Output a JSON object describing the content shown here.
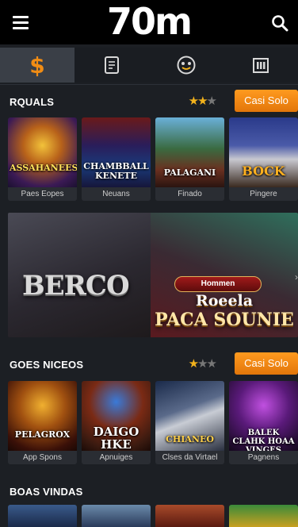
{
  "header": {
    "logo": "70m"
  },
  "tabs": [
    {
      "name": "tab-casino",
      "active": true
    },
    {
      "name": "tab-sports",
      "active": false
    },
    {
      "name": "tab-live",
      "active": false
    },
    {
      "name": "tab-bank",
      "active": false
    }
  ],
  "sections": [
    {
      "title": "RQUALS",
      "rating": 2.5,
      "cta_label": "Casi Solo",
      "games": [
        {
          "title": "ASSAHANEES",
          "caption": "Paes Eopes"
        },
        {
          "title": "CHAMBBALL KENETE",
          "caption": "Neuans"
        },
        {
          "title": "PALAGANI",
          "caption": "Finado"
        },
        {
          "title": "BOCK",
          "caption": "Pingere"
        }
      ]
    },
    {
      "title": "GOES NICEOS",
      "rating": 1.5,
      "cta_label": "Casi Solo",
      "games": [
        {
          "title": "PELAGROX",
          "caption": "App Spons"
        },
        {
          "title": "DAIGO HKE",
          "caption": "Apnuiges"
        },
        {
          "title": "CHIANEO",
          "caption": "Clses da Virtael"
        },
        {
          "title": "BALEK CLAHK HOAA VINGES",
          "caption": "Pagnens"
        }
      ]
    },
    {
      "title": "BOAS VINDAS"
    }
  ],
  "banner": {
    "left_logo": "BERCO",
    "badge": "Hommen",
    "title_line1": "Roeela",
    "title_line2": "PACA SOUNIE"
  },
  "colors": {
    "accent": "#f08c14",
    "star": "#f2b21c",
    "header": "#000000",
    "bg": "#1c1f24"
  },
  "icons": [
    "menu-icon",
    "search-icon",
    "dollar-icon",
    "receipt-icon",
    "live-icon",
    "bank-icon"
  ]
}
